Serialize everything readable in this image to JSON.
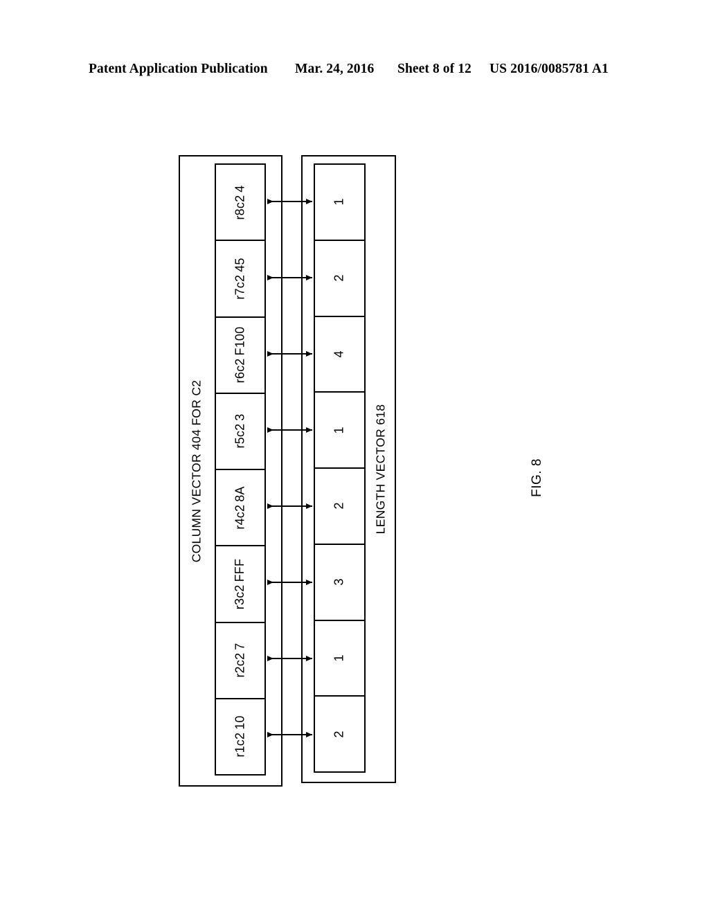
{
  "header": {
    "publication": "Patent Application Publication",
    "date": "Mar. 24, 2016",
    "sheet": "Sheet 8 of 12",
    "publication_number": "US 2016/0085781 A1"
  },
  "figure": {
    "label": "FIG. 8",
    "column_vector": {
      "caption": "COLUMN VECTOR 404 FOR C2",
      "cells": [
        {
          "id": "r8c2",
          "value": "4"
        },
        {
          "id": "r7c2",
          "value": "45"
        },
        {
          "id": "r6c2",
          "value": "F100"
        },
        {
          "id": "r5c2",
          "value": "3"
        },
        {
          "id": "r4c2",
          "value": "8A"
        },
        {
          "id": "r3c2",
          "value": "FFF"
        },
        {
          "id": "r2c2",
          "value": "7"
        },
        {
          "id": "r1c2",
          "value": "10"
        }
      ]
    },
    "length_vector": {
      "caption": "LENGTH VECTOR 618",
      "cells": [
        {
          "value": "1"
        },
        {
          "value": "2"
        },
        {
          "value": "4"
        },
        {
          "value": "1"
        },
        {
          "value": "2"
        },
        {
          "value": "3"
        },
        {
          "value": "1"
        },
        {
          "value": "2"
        }
      ]
    },
    "connector": {
      "icon": "double-headed-arrow",
      "count": 8
    },
    "colors": {
      "line": "#000000",
      "background": "#ffffff"
    }
  }
}
